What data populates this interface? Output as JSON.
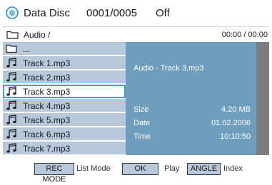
{
  "header": {
    "icon": "disc-icon",
    "title": "Data Disc",
    "counter": "0001/0005",
    "mode": "Off"
  },
  "path": {
    "icon": "folder-icon",
    "text": "Audio /",
    "time": "00:00 / 00:00"
  },
  "list": {
    "items": [
      {
        "label": "...",
        "icon": "folder-icon"
      },
      {
        "label": "Track 1.mp3",
        "icon": "music-note-icon"
      },
      {
        "label": "Track 2.mp3",
        "icon": "music-note-icon"
      },
      {
        "label": "Track 3.mp3",
        "icon": "music-note-icon",
        "selected": true
      },
      {
        "label": "Track 4.mp3",
        "icon": "music-note-icon"
      },
      {
        "label": "Track 5.mp3",
        "icon": "music-note-icon"
      },
      {
        "label": "Track 6.mp3",
        "icon": "music-note-icon"
      },
      {
        "label": "Track 7.mp3",
        "icon": "music-note-icon"
      }
    ]
  },
  "info": {
    "title": "Audio  -  Track 3.mp3",
    "size_label": "Size",
    "size_value": "4.20 MB",
    "date_label": "Date",
    "date_value": "01.02.2006",
    "time_label": "Time",
    "time_value": "10:10:50"
  },
  "footer": {
    "rec_key": "REC MODE",
    "rec_label": "List Mode",
    "ok_key": "OK",
    "ok_label": "Play",
    "angle_key": "ANGLE",
    "angle_label": "Index"
  },
  "colors": {
    "row_bg": "#b6c8da",
    "info_bg": "#6f9dbd",
    "selection_border": "#3ea0d9",
    "scrollbar": "#7d7d7d"
  }
}
